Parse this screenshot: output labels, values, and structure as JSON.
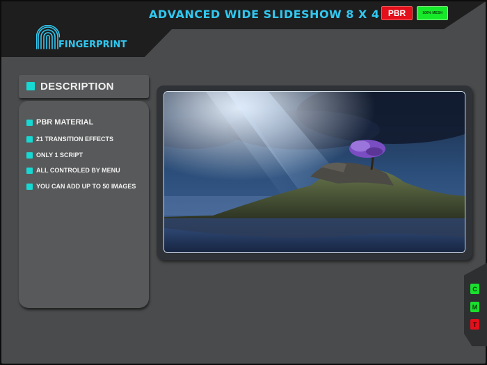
{
  "header": {
    "title": "ADVANCED WIDE SLIDESHOW 8 X 4",
    "badge_pbr": "PBR",
    "badge_mesh": "100% MESH"
  },
  "brand": {
    "name": "FINGERPRINT",
    "logo_icon": "fingerprint-icon"
  },
  "description": {
    "title": "DESCRIPTION",
    "features": [
      "PBR MATERIAL",
      "21 TRANSITION EFFECTS",
      "ONLY 1 SCRIPT",
      "ALL CONTROLED BY MENU",
      "YOU CAN ADD UP TO 50 IMAGES"
    ]
  },
  "viewer": {
    "image": "island-with-purple-tree-under-light-beam"
  },
  "side_buttons": {
    "c": "C",
    "m": "M",
    "t": "T"
  },
  "colors": {
    "accent_cyan": "#31c8f0",
    "bullet_cyan": "#17d9d4",
    "pbr_red": "#e3101b",
    "mesh_green": "#16e92a",
    "panel_gray": "#58595a",
    "background_gray": "#4a4b4c"
  }
}
